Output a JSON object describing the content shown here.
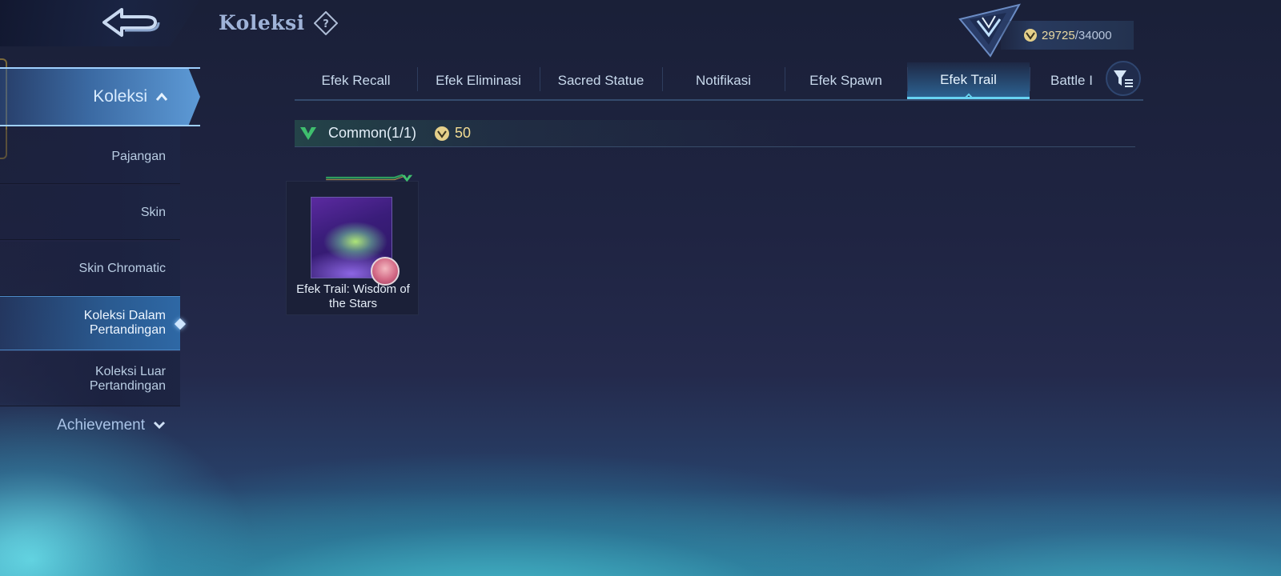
{
  "header": {
    "title": "Koleksi",
    "back_icon": "back-arrow-icon",
    "help_icon": "help-icon"
  },
  "points": {
    "current": "29725",
    "separator": "/",
    "max": "34000",
    "icon": "collector-points-icon"
  },
  "sidebar": {
    "main": {
      "label": "Koleksi",
      "expanded": true
    },
    "items": [
      {
        "label": "Pajangan"
      },
      {
        "label": "Skin"
      },
      {
        "label": "Skin Chromatic"
      },
      {
        "label": "Koleksi Dalam Pertandingan",
        "active": true
      },
      {
        "label": "Koleksi Luar Pertandingan"
      }
    ],
    "achievement": {
      "label": "Achievement",
      "expanded": false
    }
  },
  "tabs": [
    {
      "label": "Efek Recall"
    },
    {
      "label": "Efek Eliminasi"
    },
    {
      "label": "Sacred Statue"
    },
    {
      "label": "Notifikasi"
    },
    {
      "label": "Efek Spawn"
    },
    {
      "label": "Efek Trail",
      "active": true
    },
    {
      "label": "Battle I"
    }
  ],
  "section": {
    "rarity": "Common(1/1)",
    "points": "50"
  },
  "items": [
    {
      "name": "Efek Trail: Wisdom of the Stars"
    }
  ],
  "colors": {
    "accent": "#67d3f2",
    "gold": "#f2dc93",
    "rarity_green": "#3fbf6e"
  }
}
